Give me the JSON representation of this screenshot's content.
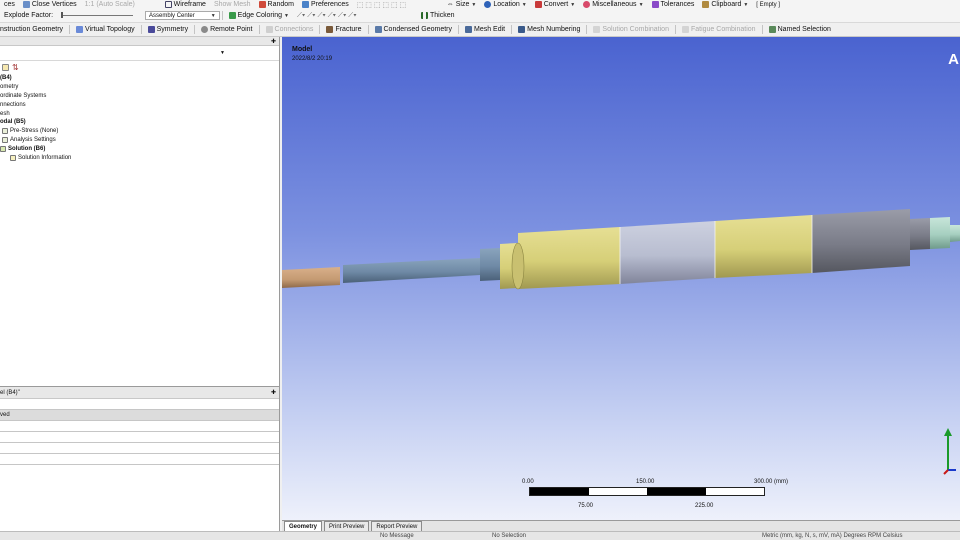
{
  "toolbar1": {
    "items": [
      "ces",
      "Close Vertices",
      "1:1 (Auto Scale)",
      "Wireframe",
      "Show Mesh",
      "Random",
      "Preferences",
      "Size",
      "Location",
      "Convert",
      "Miscellaneous",
      "Tolerances",
      "Clipboard",
      "[ Empty ]"
    ]
  },
  "toolbar2": {
    "explode_label": "Explode Factor:",
    "assembly_center": "Assembly Center",
    "edge_coloring": "Edge Coloring",
    "thicken": "Thicken"
  },
  "toolbar3": {
    "items": [
      "nstruction Geometry",
      "Virtual Topology",
      "Symmetry",
      "Remote Point",
      "Connections",
      "Fracture",
      "Condensed Geometry",
      "Mesh Edit",
      "Mesh Numbering",
      "Solution Combination",
      "Fatigue Combination",
      "Named Selection"
    ]
  },
  "outline": {
    "tree": [
      {
        "label": "(B4)",
        "bold": true
      },
      {
        "label": "ometry",
        "bold": false
      },
      {
        "label": "ordinate Systems",
        "bold": false
      },
      {
        "label": "nnections",
        "bold": false
      },
      {
        "label": "esh",
        "bold": false
      },
      {
        "label": "odal (B5)",
        "bold": true
      },
      {
        "label": "Pre-Stress (None)",
        "bold": false
      },
      {
        "label": "Analysis Settings",
        "bold": false
      },
      {
        "label": "Solution (B6)",
        "bold": true
      },
      {
        "label": "Solution Information",
        "bold": false
      }
    ]
  },
  "details": {
    "title": "el (B4)\"",
    "rows": [
      "",
      "ved",
      "",
      "",
      "",
      "",
      ""
    ]
  },
  "viewport": {
    "title": "Model",
    "date": "2022/8/2 20:19",
    "logo": "A",
    "scale": {
      "top_labels": [
        "0.00",
        "150.00",
        "300.00 (mm)"
      ],
      "bottom_labels": [
        "75.00",
        "225.00"
      ]
    }
  },
  "tabs": [
    "Geometry",
    "Print Preview",
    "Report Preview"
  ],
  "status": {
    "left": "No Message",
    "mid": "No Selection",
    "right": "Metric (mm, kg, N, s, mV, mA)  Degrees  RPM  Celsius"
  },
  "colors": {
    "viewport_top": "#4a63d0",
    "viewport_bottom": "#eef1fb",
    "shaft_olive": "#d6cf78",
    "shaft_gray": "#b8bdd0",
    "shaft_dark": "#7a7c88",
    "shaft_blue": "#6f8aa6",
    "shaft_copper": "#c49a72",
    "shaft_green": "#a6cfc0"
  }
}
